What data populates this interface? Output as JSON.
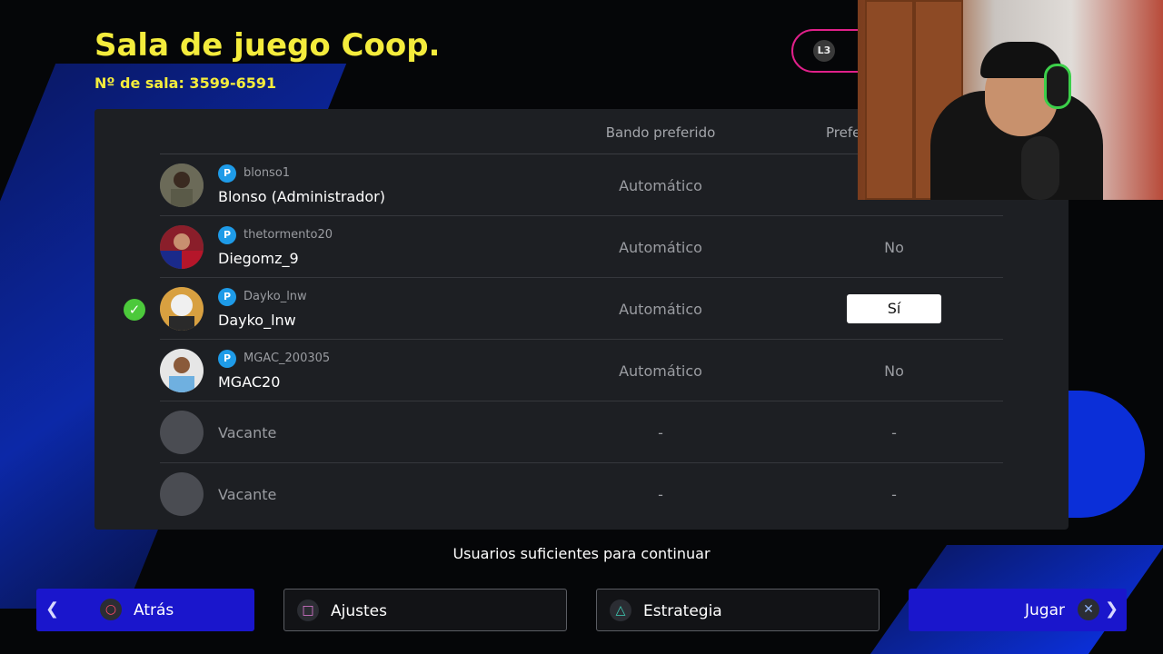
{
  "room": {
    "title": "Sala de juego Coop.",
    "number_label": "Nº de sala: 3599-6591",
    "l3_label": "L3"
  },
  "table": {
    "headers": {
      "side": "Bando preferido",
      "pref": "Prefe"
    },
    "rows": [
      {
        "psn_id": "blonso1",
        "name": "Blonso (Administrador)",
        "side": "Automático",
        "pref": ""
      },
      {
        "psn_id": "thetormento20",
        "name": "Diegomz_9",
        "side": "Automático",
        "pref": "No"
      },
      {
        "psn_id": "Dayko_lnw",
        "name": "Dayko_lnw",
        "side": "Automático",
        "pref": "Sí"
      },
      {
        "psn_id": "MGAC_200305",
        "name": "MGAC20",
        "side": "Automático",
        "pref": "No"
      },
      {
        "name": "Vacante",
        "side": "-",
        "pref": "-"
      },
      {
        "name": "Vacante",
        "side": "-",
        "pref": "-"
      }
    ]
  },
  "status_text": "Usuarios suficientes para continuar",
  "footer": {
    "back_label": "Atrás",
    "settings_label": "Ajustes",
    "strategy_label": "Estrategia",
    "play_label": "Jugar"
  },
  "icons": {
    "back": "circle-button-icon",
    "settings": "square-button-icon",
    "strategy": "triangle-button-icon",
    "play": "cross-button-icon",
    "platform": "playstation-icon",
    "ready": "check-icon"
  },
  "colors": {
    "title": "#f4ec3c",
    "accent_blue": "#1a16cc",
    "ready_green": "#4cc93b",
    "l3_border": "#e0208a"
  }
}
